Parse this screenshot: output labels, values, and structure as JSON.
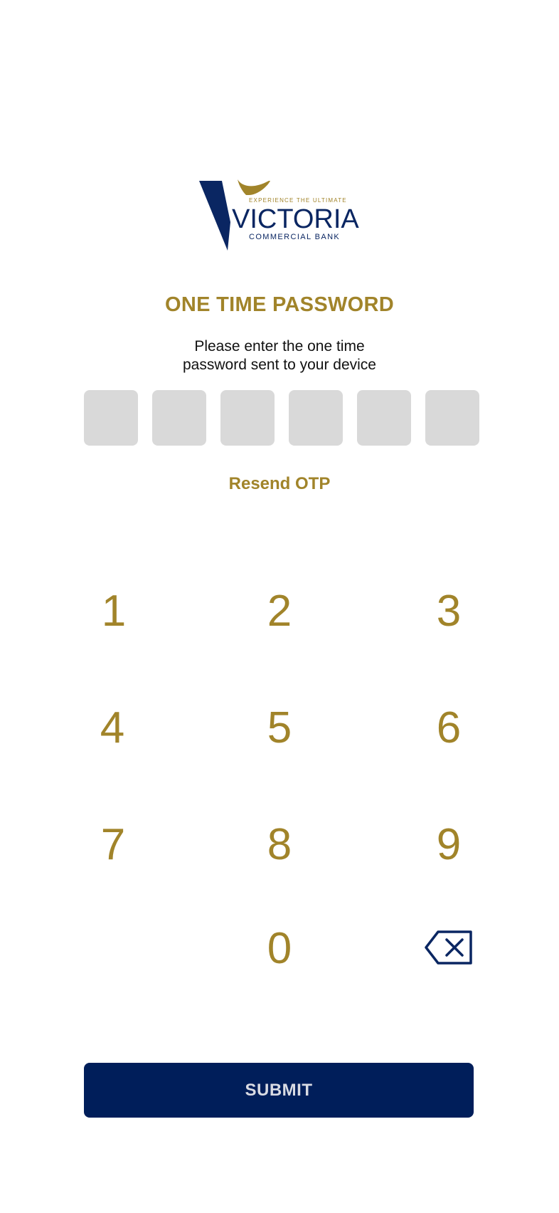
{
  "brand": {
    "tagline": "EXPERIENCE THE ULTIMATE",
    "name": "VICTORIA",
    "subname": "COMMERCIAL BANK",
    "navy": "#0a2662",
    "gold": "#a1842a"
  },
  "otp": {
    "title": "ONE TIME PASSWORD",
    "instruction_line1": "Please enter the one time",
    "instruction_line2": "password sent to your device",
    "digits": [
      "",
      "",
      "",
      "",
      "",
      ""
    ],
    "resend_label": "Resend OTP"
  },
  "keypad": {
    "keys": [
      "1",
      "2",
      "3",
      "4",
      "5",
      "6",
      "7",
      "8",
      "9",
      "0"
    ],
    "backspace_icon": "backspace-icon"
  },
  "submit_label": "SUBMIT",
  "colors": {
    "accent": "#a1842a",
    "primary": "#001e5a",
    "otp_box": "#d9d9d9"
  }
}
